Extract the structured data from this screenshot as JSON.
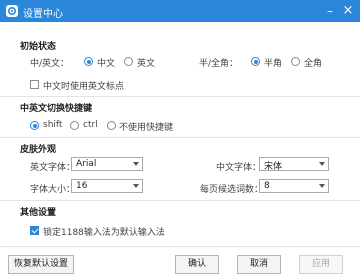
{
  "window": {
    "title": "设置中心",
    "minimize_symbol": "–",
    "close_symbol": "×",
    "accent": "#2a86d8"
  },
  "initial_state": {
    "heading": "初始状态",
    "cn_en_label": "中/英文：",
    "option_cn": "中文",
    "option_en": "英文",
    "cn_en_selected": "中文",
    "width_label": "半/全角：",
    "option_half": "半角",
    "option_full": "全角",
    "width_selected": "半角",
    "punct_checkbox_label": "中文时使用英文标点",
    "punct_checked": false
  },
  "switch_key": {
    "heading": "中英文切换快捷键",
    "option_shift": "shift",
    "option_ctrl": "ctrl",
    "option_none": "不使用快捷键",
    "selected": "shift"
  },
  "skin": {
    "heading": "皮肤外观",
    "en_font_label": "英文字体：",
    "en_font_value": "Arial",
    "cn_font_label": "中文字体：",
    "cn_font_value": "宋体",
    "font_size_label": "字体大小：",
    "font_size_value": "16",
    "candidates_label": "每页候选词数：",
    "candidates_value": "8"
  },
  "other": {
    "heading": "其他设置",
    "lock_checkbox_label": "锁定1188输入法为默认输入法",
    "lock_checked": true
  },
  "footer": {
    "restore_label": "恢复默认设置",
    "ok_label": "确认",
    "cancel_label": "取消",
    "apply_label": "应用"
  }
}
